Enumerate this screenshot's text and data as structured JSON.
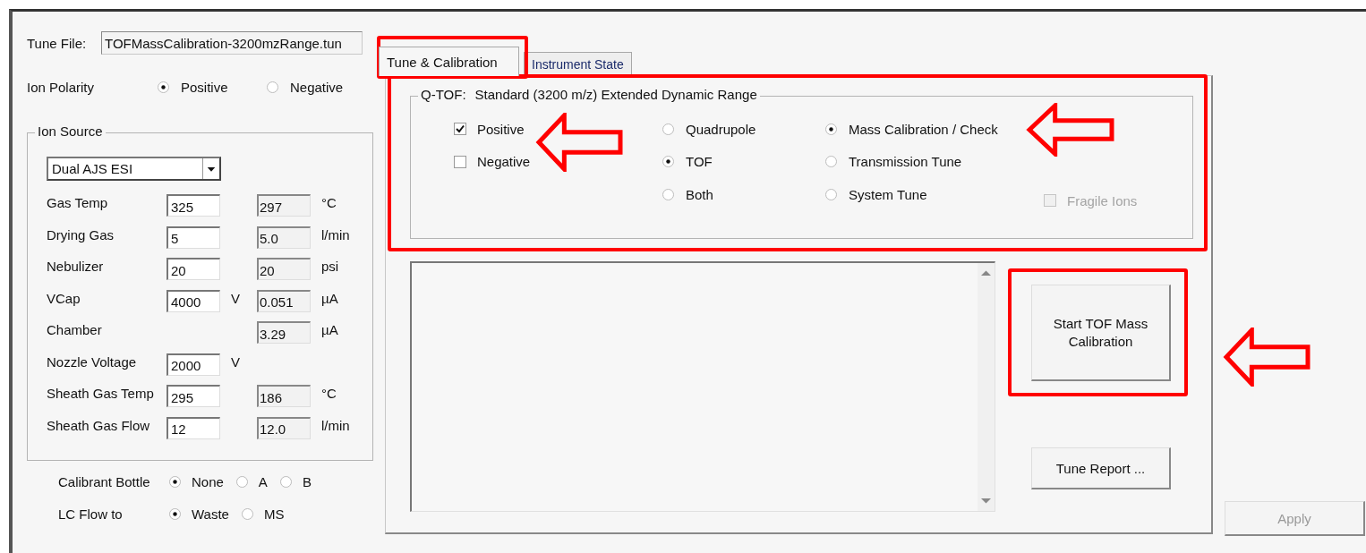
{
  "tune_file": {
    "label": "Tune File:",
    "value": "TOFMassCalibration-3200mzRange.tun"
  },
  "ion_polarity": {
    "label": "Ion Polarity",
    "options": [
      {
        "label": "Positive",
        "selected": true
      },
      {
        "label": "Negative",
        "selected": false
      }
    ]
  },
  "ion_source": {
    "title": "Ion Source",
    "source": "Dual AJS ESI",
    "rows": [
      {
        "label": "Gas Temp",
        "setpoint": "325",
        "actual": "297",
        "unit": "°C"
      },
      {
        "label": "Drying Gas",
        "setpoint": "5",
        "actual": "5.0",
        "unit": "l/min"
      },
      {
        "label": "Nebulizer",
        "setpoint": "20",
        "actual": "20",
        "unit": "psi"
      },
      {
        "label": "VCap",
        "setpoint": "4000",
        "setpoint_unit": "V",
        "actual": "0.051",
        "unit": "µA"
      },
      {
        "label": "Chamber",
        "actual": "3.29",
        "unit": "µA"
      },
      {
        "label": "Nozzle Voltage",
        "setpoint": "2000",
        "setpoint_unit": "V"
      },
      {
        "label": "Sheath Gas Temp",
        "setpoint": "295",
        "actual": "186",
        "unit": "°C"
      },
      {
        "label": "Sheath Gas Flow",
        "setpoint": "12",
        "actual": "12.0",
        "unit": "l/min"
      }
    ]
  },
  "calibrant_bottle": {
    "label": "Calibrant Bottle",
    "options": [
      {
        "label": "None",
        "selected": true
      },
      {
        "label": "A",
        "selected": false
      },
      {
        "label": "B",
        "selected": false
      }
    ]
  },
  "lc_flow_to": {
    "label": "LC Flow to",
    "options": [
      {
        "label": "Waste",
        "selected": true
      },
      {
        "label": "MS",
        "selected": false
      }
    ]
  },
  "tabs": [
    {
      "label": "Tune & Calibration",
      "selected": true
    },
    {
      "label": "Instrument State",
      "selected": false
    }
  ],
  "qtof": {
    "label": "Q-TOF:",
    "mode": "Standard (3200 m/z) Extended Dynamic Range",
    "polarity": [
      {
        "label": "Positive",
        "checked": true
      },
      {
        "label": "Negative",
        "checked": false
      }
    ],
    "analyzer": [
      {
        "label": "Quadrupole",
        "selected": false
      },
      {
        "label": "TOF",
        "selected": true
      },
      {
        "label": "Both",
        "selected": false
      }
    ],
    "task": [
      {
        "label": "Mass Calibration / Check",
        "selected": true
      },
      {
        "label": "Transmission Tune",
        "selected": false
      },
      {
        "label": "System Tune",
        "selected": false
      }
    ],
    "fragile_ions": {
      "label": "Fragile Ions",
      "checked": false,
      "disabled": true
    }
  },
  "start_button": {
    "label": "Start TOF Mass Calibration"
  },
  "tune_report_button": {
    "label": "Tune Report ..."
  },
  "apply_button": {
    "label": "Apply",
    "disabled": true
  }
}
